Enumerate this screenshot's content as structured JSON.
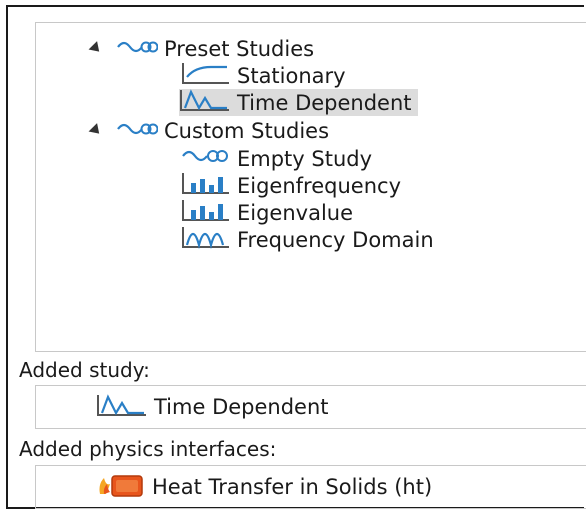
{
  "tree": {
    "preset_label": "Preset Studies",
    "preset_items": [
      "Stationary",
      "Time Dependent"
    ],
    "custom_label": "Custom Studies",
    "custom_items": [
      "Empty Study",
      "Eigenfrequency",
      "Eigenvalue",
      "Frequency Domain"
    ],
    "selected": "Time Dependent"
  },
  "added_study": {
    "label": "Added study:",
    "value": "Time Dependent"
  },
  "added_physics": {
    "label": "Added physics interfaces:",
    "value": "Heat Transfer in Solids (ht)"
  },
  "icons": {
    "group": "study-group-icon",
    "stationary": "stationary-icon",
    "time_dependent": "time-dependent-icon",
    "empty_study": "empty-study-icon",
    "eigen": "bar-chart-icon",
    "frequency_domain": "frequency-domain-icon",
    "heat": "heat-transfer-icon"
  },
  "colors": {
    "accent_blue": "#2a7fc6",
    "selection": "#dcdcdc",
    "heat_orange": "#e8551c"
  }
}
